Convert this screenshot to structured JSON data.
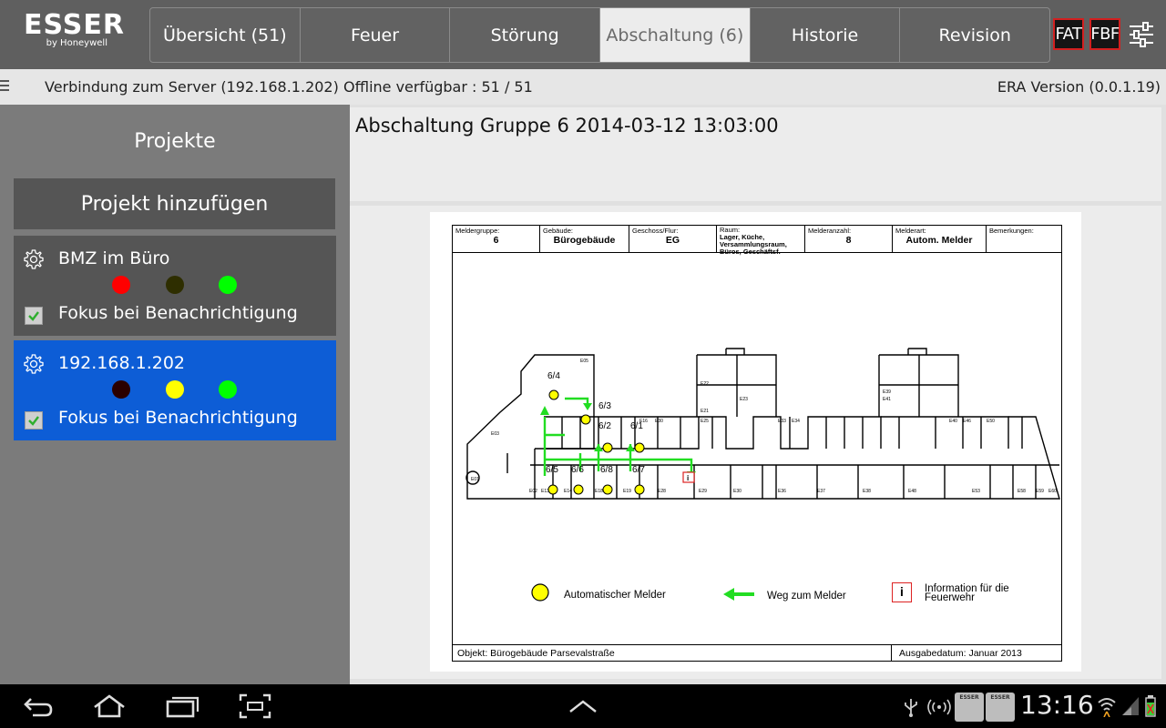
{
  "header": {
    "logo_main": "ESSER",
    "logo_sub": "by Honeywell",
    "tabs": [
      {
        "label": "Übersicht (51)"
      },
      {
        "label": "Feuer"
      },
      {
        "label": "Störung"
      },
      {
        "label": "Abschaltung (6)"
      },
      {
        "label": "Historie"
      },
      {
        "label": "Revision"
      }
    ],
    "active_tab": "Abschaltung (6)",
    "fat_label": "FAT",
    "fbf_label": "FBF"
  },
  "status": {
    "connection": "Verbindung zum Server (192.168.1.202)",
    "offline": "Offline verfügbar : 51 / 51",
    "version": "ERA Version (0.0.1.19)"
  },
  "sidebar": {
    "title": "Projekte",
    "add_button": "Projekt hinzufügen",
    "projects": [
      {
        "name": "BMZ im Büro",
        "focus_label": "Fokus bei Benachrichtigung",
        "focus_checked": true,
        "selected": false,
        "indicators": [
          "#ff0000",
          "#2e2e00",
          "#00ff00"
        ]
      },
      {
        "name": "192.168.1.202",
        "focus_label": "Fokus bei Benachrichtigung",
        "focus_checked": true,
        "selected": true,
        "indicators": [
          "#2a0000",
          "#ffff00",
          "#00ff00"
        ]
      }
    ]
  },
  "content": {
    "title": "Abschaltung Gruppe 6 2014-03-12 13:03:00"
  },
  "floorplan": {
    "fields": [
      {
        "label": "Meldergruppe:",
        "value": "6"
      },
      {
        "label": "Gebäude:",
        "value": "Bürogebäude"
      },
      {
        "label": "Geschoss/Flur:",
        "value": "EG"
      },
      {
        "label": "Raum:",
        "value": "Lager, Küche, Versammlungsraum, Büros, Geschäftsf."
      },
      {
        "label": "Melderanzahl:",
        "value": "8"
      },
      {
        "label": "Melderart:",
        "value": "Autom. Melder"
      },
      {
        "label": "Bemerkungen:",
        "value": ""
      }
    ],
    "detectors": [
      "6/4",
      "6/3",
      "6/2",
      "6/1",
      "6/5",
      "6/6",
      "6/8",
      "6/7"
    ],
    "legend": {
      "detector": "Automatischer Melder",
      "path": "Weg zum Melder",
      "info": "Information für die Feuerwehr",
      "info_symbol": "i"
    },
    "footer_object": "Objekt: Bürogebäude Parsevalstraße",
    "footer_date": "Ausgabedatum: Januar 2013"
  },
  "navbar": {
    "time": "13:16",
    "mini_app_label": "ESSER"
  },
  "colors": {
    "header_bg": "#5f5f5f",
    "selected_project": "#0d5dd6",
    "detector_yellow": "#ffff00",
    "path_green": "#22dd22",
    "alarm_red": "#d32020"
  }
}
